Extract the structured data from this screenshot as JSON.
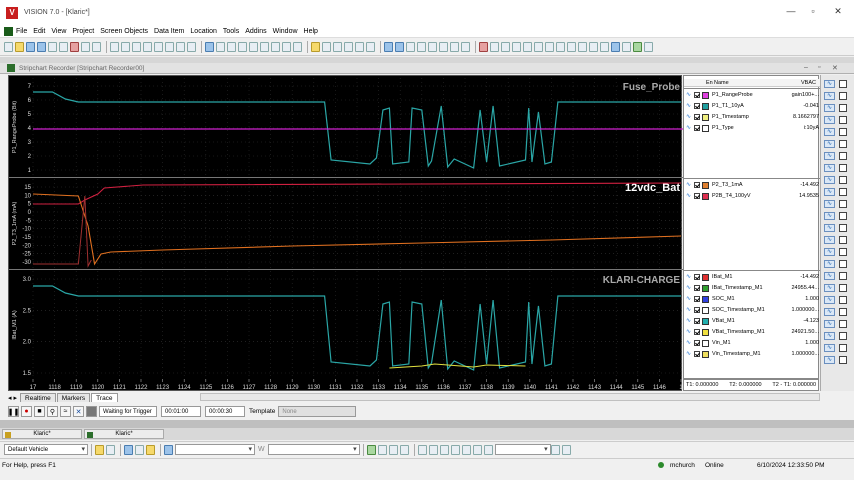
{
  "window": {
    "title": "VISION 7.0 - [Klaric*]",
    "logo_text": "V"
  },
  "menu": [
    "File",
    "Edit",
    "View",
    "Project",
    "Screen Objects",
    "Data Item",
    "Location",
    "Tools",
    "Addins",
    "Window",
    "Help"
  ],
  "subwindow": {
    "title": "Stripchart Recorder [Stripchart Recorder00]"
  },
  "panels": [
    {
      "title": "Fuse_Probe",
      "ylabel": "P1_RangeProbe (Bit)",
      "ylim": [
        1,
        7
      ],
      "ticks": [
        "7",
        "6",
        "5",
        "4",
        "3",
        "2",
        "1"
      ]
    },
    {
      "title": "12vdc_Bat",
      "ylabel": "P2_T3_1mA (mA)",
      "ylim": [
        -30,
        15
      ],
      "ticks": [
        "15",
        "10",
        "5",
        "0",
        "-5",
        "-10",
        "-15",
        "-20",
        "-25",
        "-30"
      ]
    },
    {
      "title": "KLARI-CHARGE",
      "ylabel": "IBat_M1 (A)",
      "ylim": [
        1.5,
        3.0
      ],
      "ticks": [
        "3.0",
        "2.5",
        "2.0",
        "1.5"
      ]
    }
  ],
  "xaxis": {
    "ticks": [
      "17",
      "1118",
      "1119",
      "1120",
      "1121",
      "1122",
      "1123",
      "1124",
      "1125",
      "1126",
      "1127",
      "1128",
      "1129",
      "1130",
      "1131",
      "1132",
      "1133",
      "1134",
      "1135",
      "1136",
      "1137",
      "1138",
      "1139",
      "1140",
      "1141",
      "1142",
      "1143",
      "1144",
      "1145",
      "1146",
      "1"
    ]
  },
  "legend": {
    "headers": {
      "en": "En",
      "name": "Name",
      "value": "VBAC"
    },
    "groups": [
      [
        {
          "name": "P1_RangeProbe",
          "value": "gain100+...",
          "color": "#e040e0",
          "checked": true
        },
        {
          "name": "P1_T1_10yA",
          "value": "-0.041",
          "color": "#20a0a0",
          "checked": true
        },
        {
          "name": "P1_Timestamp",
          "value": "8.1662797",
          "color": "#f0f080",
          "checked": true
        },
        {
          "name": "P1_Type",
          "value": "i:10yA",
          "color": "#ffffff",
          "checked": true
        }
      ],
      [
        {
          "name": "P2_T3_1mA",
          "value": "-14.492",
          "color": "#e08030",
          "checked": true
        },
        {
          "name": "P2B_T4_100yV",
          "value": "14.9535",
          "color": "#e03050",
          "checked": true
        }
      ],
      [
        {
          "name": "IBat_M1",
          "value": "-14.492",
          "color": "#e03030",
          "checked": true
        },
        {
          "name": "IBat_Timestamp_M1",
          "value": "24955.44...",
          "color": "#30a030",
          "checked": true
        },
        {
          "name": "SOC_M1",
          "value": "1.000",
          "color": "#3040e0",
          "checked": true
        },
        {
          "name": "SOC_Timestamp_M1",
          "value": "1.000000...",
          "color": "#ffffff",
          "checked": true
        },
        {
          "name": "VBat_M1",
          "value": "-4.123",
          "color": "#20b0b0",
          "checked": true
        },
        {
          "name": "VBat_Timestamp_M1",
          "value": "24921.50...",
          "color": "#f0e040",
          "checked": true
        },
        {
          "name": "Vin_M1",
          "value": "1.000",
          "color": "#ffffff",
          "checked": true
        },
        {
          "name": "Vin_Timestamp_M1",
          "value": "1.000000...",
          "color": "#f0e060",
          "checked": true
        }
      ]
    ]
  },
  "time_readout": {
    "t1": "T1: 0.000000",
    "t2": "T2: 0.000000",
    "diff": "T2 - T1: 0.000000"
  },
  "tabs": [
    "Realtime",
    "Markers",
    "Trace"
  ],
  "active_tab": "Trace",
  "controls": {
    "status": "Waiting for Trigger",
    "time1": "00:01:00",
    "time2": "00:00:30",
    "template_label": "Template",
    "template_value": "None"
  },
  "doc_tabs": [
    "Klaric*",
    "Klaric*"
  ],
  "bottom": {
    "vehicle": "Default Vehicle",
    "w_label": "W"
  },
  "status": {
    "help": "For Help, press F1",
    "user": "mchurch",
    "state": "Online",
    "datetime": "6/10/2024 12:33:50 PM"
  },
  "colors": {
    "trace_teal": "#2aa6a6",
    "trace_magenta": "#d020d0",
    "trace_orange": "#e07020",
    "trace_red": "#d02040",
    "trace_yellow": "#e0e040"
  }
}
